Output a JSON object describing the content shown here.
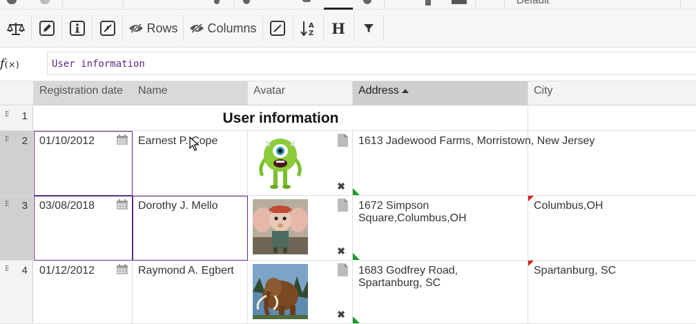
{
  "toolbar": {
    "rows_label": "Rows",
    "columns_label": "Columns",
    "header_button_label": "H",
    "font_selector_partial": "Default",
    "icons": [
      "balance-scale-icon",
      "pencil-icon",
      "info-icon",
      "compress-icon",
      "eye-slash-icon",
      "magic-wand-icon",
      "sort-alpha-icon",
      "heading-icon",
      "filter-icon"
    ]
  },
  "formula": {
    "fx_symbol": "f",
    "fx_sub": "(×)",
    "value": "User information"
  },
  "columns": [
    {
      "label": "Registration date"
    },
    {
      "label": "Name"
    },
    {
      "label": "Avatar"
    },
    {
      "label": "Address"
    },
    {
      "label": "City"
    }
  ],
  "sort": {
    "column": "Address",
    "direction": "ascending"
  },
  "title_row": {
    "number": "1",
    "text": "User information"
  },
  "rows": [
    {
      "number": "2",
      "date": "01/10/2012",
      "name": "Earnest P. Cope",
      "avatar": "green one-eyed monster",
      "address": "1613 Jadewood Farms, Morristown, New Jersey",
      "city": ""
    },
    {
      "number": "3",
      "date": "03/08/2018",
      "name": "Dorothy J. Mello",
      "avatar": "mouse with red cap",
      "address": "1672 Simpson Square,Columbus,OH",
      "city": "Columbus,OH"
    },
    {
      "number": "4",
      "date": "01/12/2012",
      "name": "Raymond A. Egbert",
      "avatar": "woolly mammoth",
      "address": "1683 Godfrey Road, Spartanburg, SC",
      "city": "Spartanburg, SC"
    }
  ],
  "colors": {
    "selection": "#5b2a86",
    "comment_green": "#1a9b2b",
    "comment_red": "#e21b1b"
  }
}
